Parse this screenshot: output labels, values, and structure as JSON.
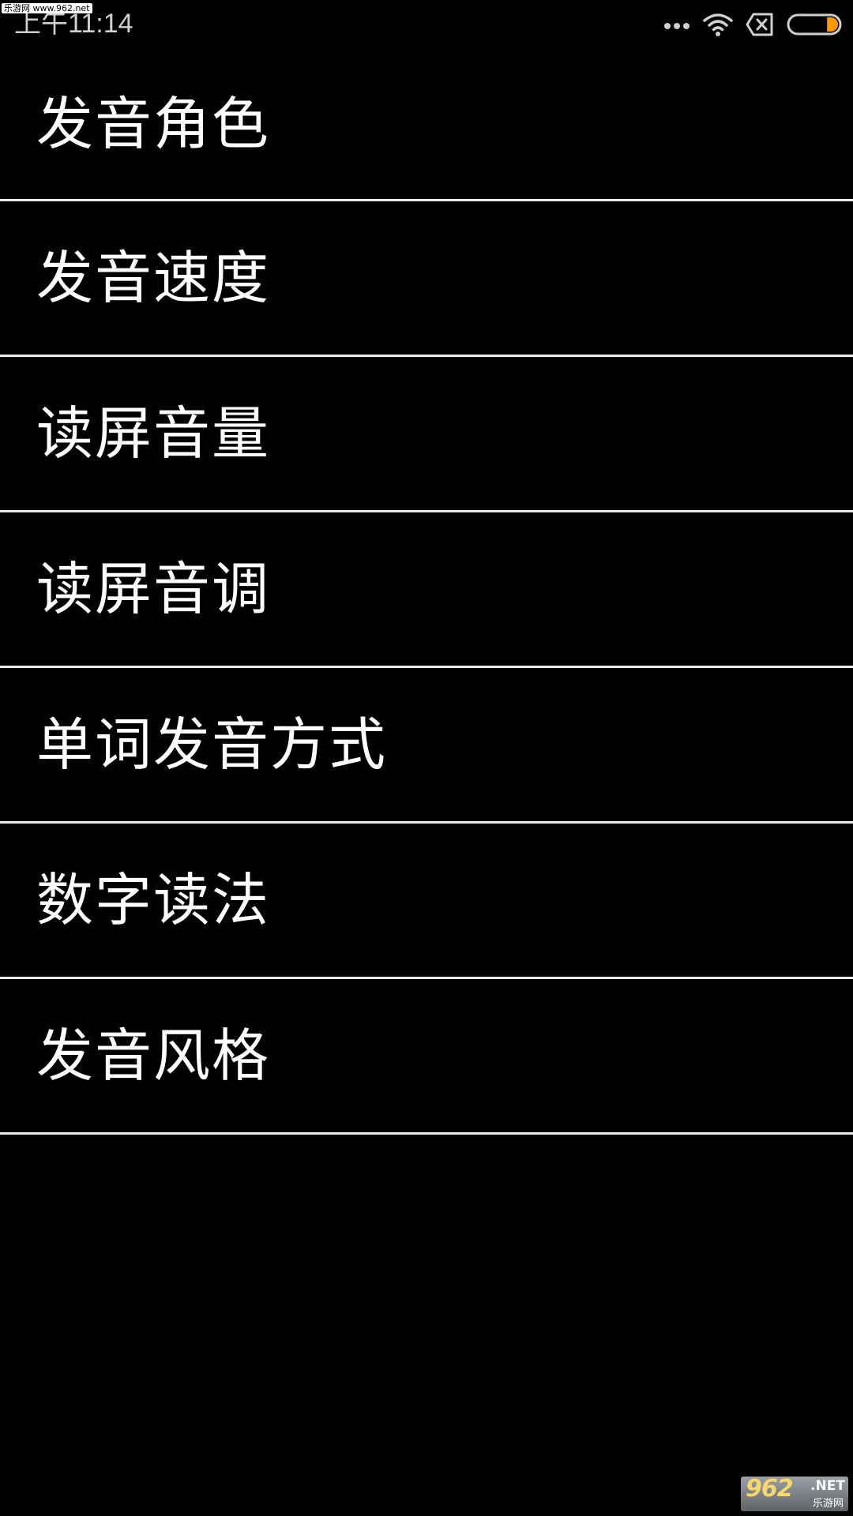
{
  "watermark_top": "乐游网 www.962.net",
  "status_bar": {
    "time": "上午11:14",
    "icons": [
      "more-dots-icon",
      "wifi-icon",
      "no-sim-icon",
      "battery-icon"
    ],
    "battery_level": 0.2,
    "battery_color": "#ff9800"
  },
  "menu": {
    "items": [
      {
        "label": "发音角色"
      },
      {
        "label": "发音速度"
      },
      {
        "label": "读屏音量"
      },
      {
        "label": "读屏音调"
      },
      {
        "label": "单词发音方式"
      },
      {
        "label": "数字读法"
      },
      {
        "label": "发音风格"
      }
    ]
  },
  "watermark_bottom": {
    "number": "962",
    "suffix": ".NET",
    "name": "乐游网"
  },
  "colors": {
    "background": "#000000",
    "text": "#ffffff",
    "divider": "#e8e8e8"
  }
}
